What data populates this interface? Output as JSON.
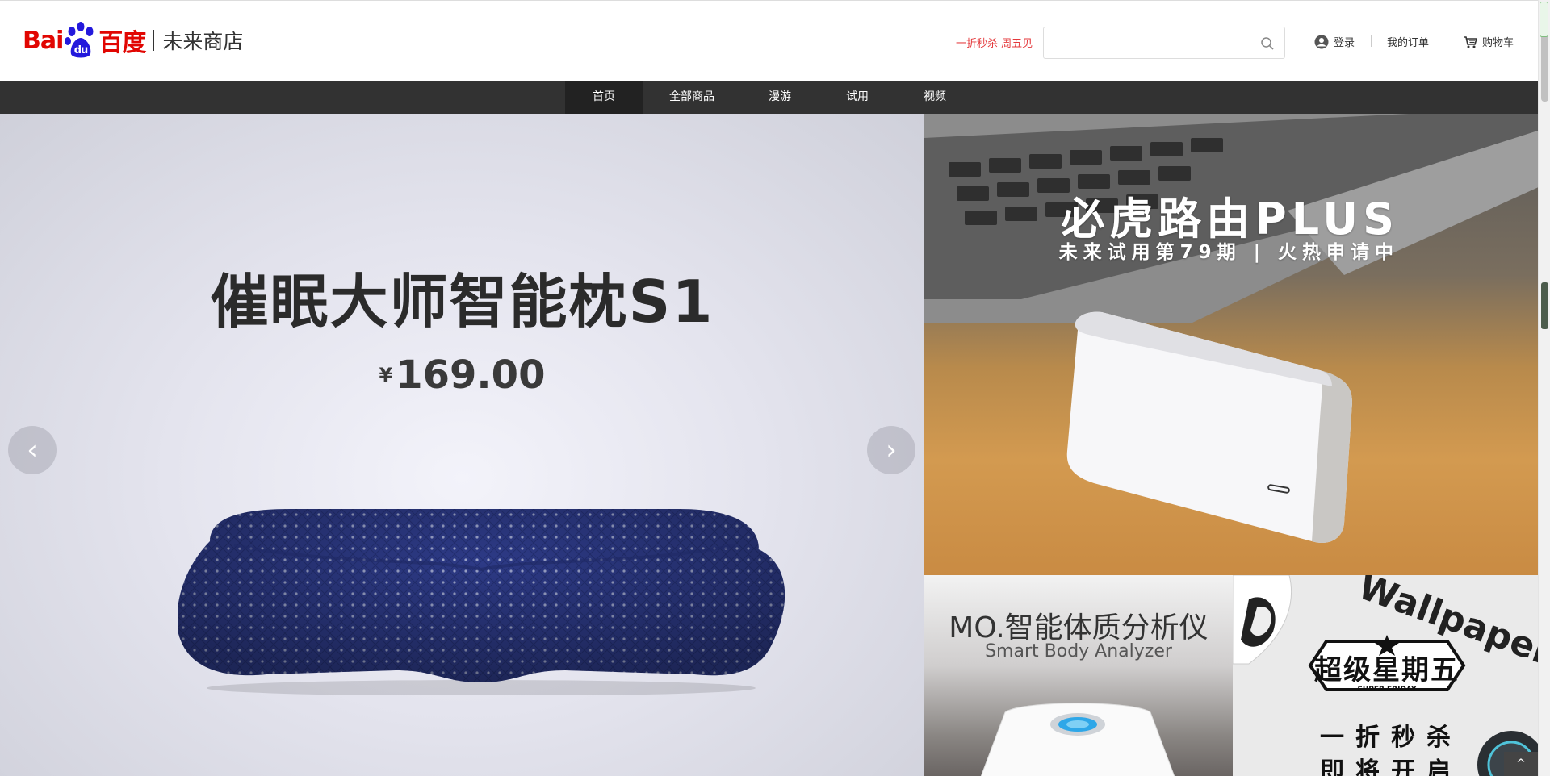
{
  "header": {
    "logo": {
      "bai": "Bai",
      "du_paw": "du",
      "du_text": "百度",
      "store_name": "未来商店"
    },
    "promo_link": "一折秒杀 周五见",
    "search": {
      "value": "",
      "placeholder": ""
    },
    "login_label": "登录",
    "orders_label": "我的订单",
    "cart_label": "购物车"
  },
  "nav": {
    "items": [
      {
        "label": "首页",
        "active": true
      },
      {
        "label": "全部商品",
        "active": false
      },
      {
        "label": "漫游",
        "active": false
      },
      {
        "label": "试用",
        "active": false
      },
      {
        "label": "视频",
        "active": false
      }
    ]
  },
  "hero": {
    "title": "催眠大师智能枕S1",
    "currency": "¥",
    "price": "169.00",
    "prev_arrow": "‹",
    "next_arrow": "›"
  },
  "tiles": {
    "router": {
      "title": "必虎路由PLUS",
      "subtitle": "未来试用第79期 | 火热申请中"
    },
    "scale": {
      "title": "MO.智能体质分析仪",
      "subtitle": "Smart Body Analyzer"
    },
    "super_friday": {
      "brand": "Wallpaper",
      "badge": "超级星期五",
      "badge_sub": "SUPER FRIDAY",
      "line1": "一折秒杀",
      "line2": "即将开启"
    }
  },
  "colors": {
    "brand_red": "#e10602",
    "brand_blue": "#2319dc",
    "promo_red": "#e4393c",
    "nav_bg": "#323232"
  },
  "icons": {
    "search": "search-icon",
    "user": "user-icon",
    "cart": "cart-icon"
  },
  "back_to_top": "^"
}
